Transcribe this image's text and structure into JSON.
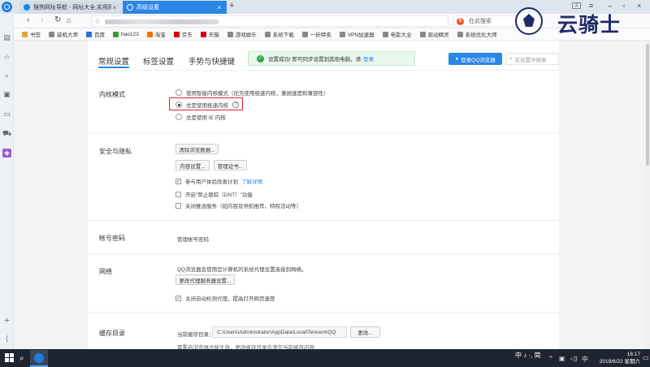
{
  "tabs": [
    {
      "title": "搜狗网址导航 - 网址大全,实用网址",
      "active": false
    },
    {
      "title": "高级设置",
      "active": true
    }
  ],
  "tabbar_right": {
    "count": "2"
  },
  "address": {
    "search_placeholder": "在此搜索",
    "search_engine": "S"
  },
  "bookmarks": [
    {
      "label": "书签",
      "color": "#e6a23c"
    },
    {
      "label": "装机大师",
      "color": "#888888"
    },
    {
      "label": "百度",
      "color": "#2f6fd6"
    },
    {
      "label": "hao123",
      "color": "#2aa52a"
    },
    {
      "label": "淘宝",
      "color": "#ff6a00"
    },
    {
      "label": "京东",
      "color": "#d7000f"
    },
    {
      "label": "天猫",
      "color": "#d7000f"
    },
    {
      "label": "游戏娱乐",
      "color": "#888888"
    },
    {
      "label": "系统下载",
      "color": "#888888"
    },
    {
      "label": "一折特卖",
      "color": "#888888"
    },
    {
      "label": "VPN加速器",
      "color": "#888888"
    },
    {
      "label": "电影大全",
      "color": "#888888"
    },
    {
      "label": "驱动精灵",
      "color": "#888888"
    },
    {
      "label": "系统优化大师",
      "color": "#888888"
    }
  ],
  "watermark": {
    "text": "云骑士"
  },
  "settings": {
    "tabs": [
      "常规设置",
      "标签设置",
      "手势与快捷键"
    ],
    "notice": {
      "text": "设置成功! 即可同步设置到其他电脑，请",
      "link": "登录"
    },
    "login_button": "登录QQ浏览器",
    "search_placeholder": "在设置中搜索",
    "kernel": {
      "title": "内核模式",
      "options": [
        {
          "label": "使用智能内核模式（优先使用极速内核，兼顾速度和兼容性）",
          "selected": false
        },
        {
          "label": "总是使用极速内核",
          "selected": true
        },
        {
          "label": "总是使用 IE 内核",
          "selected": false
        }
      ],
      "help": "?"
    },
    "security": {
      "title": "安全与隐私",
      "clear_button": "清除浏览数据...",
      "content_button": "内容设置...",
      "cert_button": "管理证书...",
      "checks": [
        {
          "label": "参与用户体验改善计划",
          "link": "了解详情",
          "checked": true
        },
        {
          "label": "开启\"禁止跟踪（DNT）\"功能",
          "link": "",
          "checked": false
        },
        {
          "label": "关闭推送服务（如内容及导航推荐、特权活动等）",
          "link": "",
          "checked": false
        }
      ]
    },
    "account": {
      "title": "帐号密码",
      "link": "管理帐号密码"
    },
    "network": {
      "title": "网络",
      "desc": "QQ浏览器会使用您计算机的系统代理设置连接到网络。",
      "proxy_button": "更改代理服务器设置...",
      "check": {
        "label": "关闭自动检测代理，提高打开网页速度",
        "checked": true
      }
    },
    "cache": {
      "title": "缓存目录",
      "label": "当前缓存目录：",
      "path": "C:\\Users\\Administrator\\AppData\\Local\\Tencent\\QQ",
      "change_button": "更改...",
      "note": "需重启浏览器才能生效，更改缓存目录会清空当前缓存内容"
    }
  },
  "taskbar": {
    "ime": "中 ♪ ·, 简",
    "time": "16:17",
    "date": "2019/6/22 星期六"
  }
}
